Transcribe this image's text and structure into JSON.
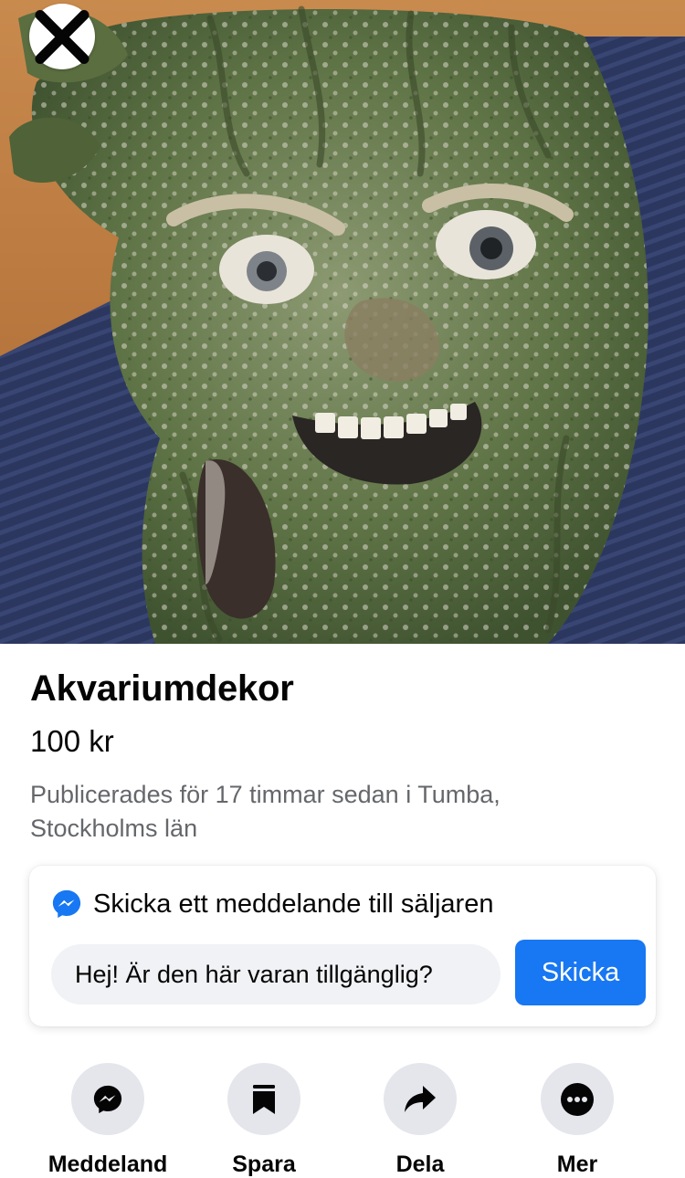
{
  "photo": {
    "subject": "tree-face-aquarium-ornament"
  },
  "close_button": {
    "icon": "close-icon"
  },
  "listing": {
    "title": "Akvariumdekor",
    "price": "100 kr",
    "published": "Publicerades för 17 timmar sedan i Tumba, Stockholms län"
  },
  "message": {
    "header": "Skicka ett meddelande till säljaren",
    "icon": "messenger-icon",
    "input_value": "Hej! Är den här varan tillgänglig?",
    "send_label": "Skicka"
  },
  "actions": [
    {
      "label": "Meddeland",
      "icon": "messenger-icon"
    },
    {
      "label": "Spara",
      "icon": "bookmark-icon"
    },
    {
      "label": "Dela",
      "icon": "share-arrow-icon"
    },
    {
      "label": "Mer",
      "icon": "more-dots-icon"
    }
  ],
  "colors": {
    "accent": "#1877f2",
    "secondary_text": "#65676b",
    "action_circle": "#e4e6eb",
    "input_background": "#f0f2f5"
  }
}
